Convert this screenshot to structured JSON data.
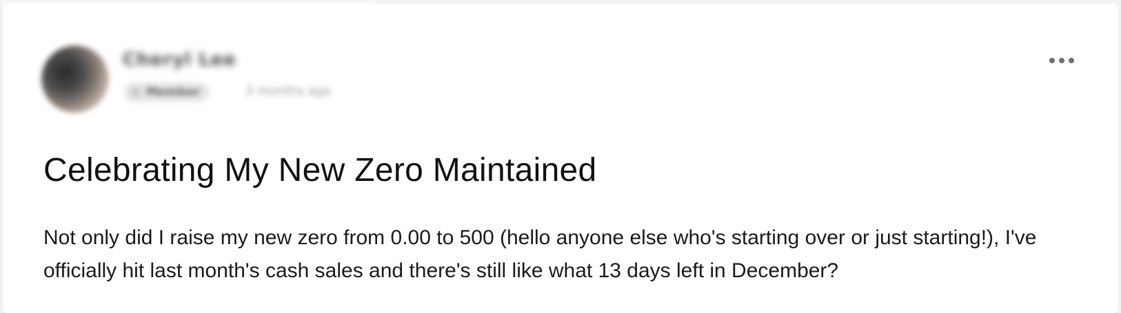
{
  "post": {
    "author": {
      "name": "Cheryl Lee",
      "role": "Member",
      "timestamp": "3 months ago"
    },
    "title": "Celebrating My New Zero Maintained",
    "body": "Not only did I raise my new zero from 0.00 to 500 (hello anyone else who's starting over or just starting!), I've officially hit last month's cash sales and there's still like what 13 days left in December?",
    "menu_icon": "more-horizontal-icon"
  }
}
